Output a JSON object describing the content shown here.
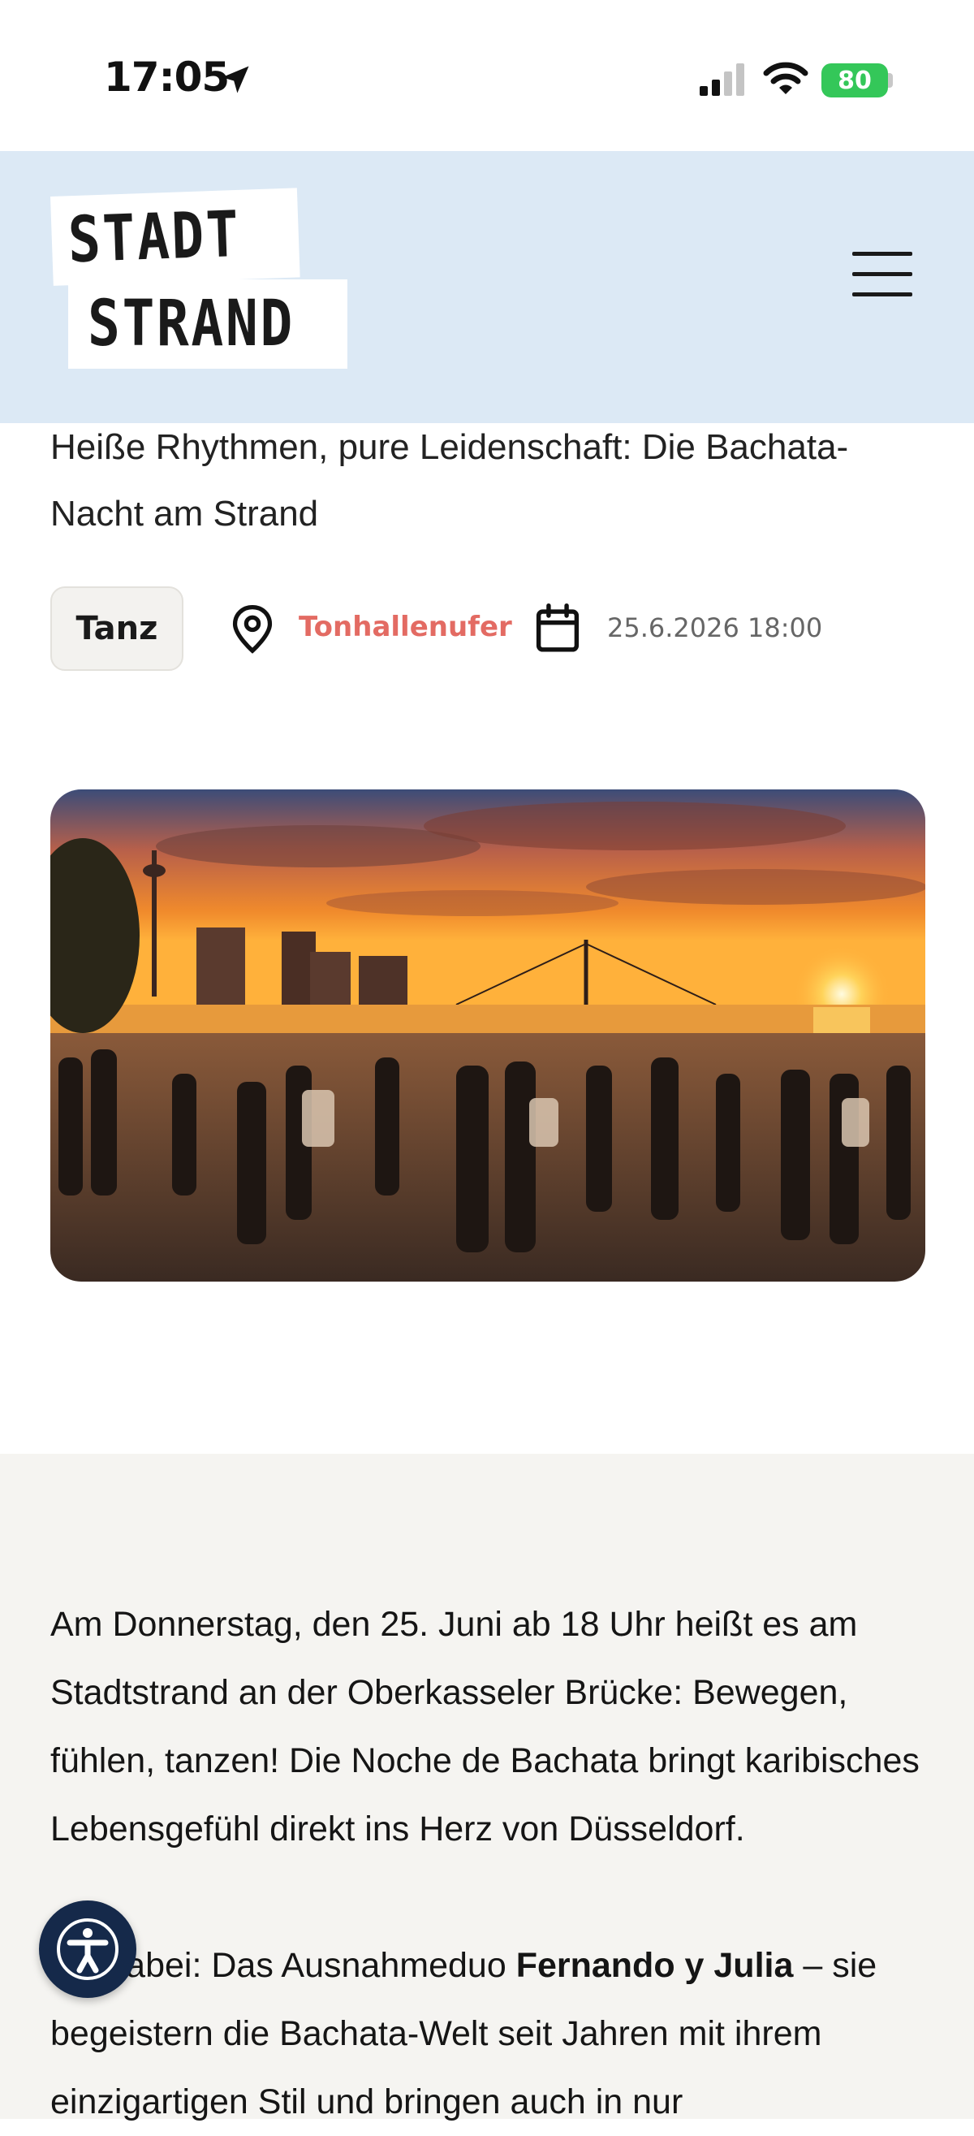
{
  "status_bar": {
    "time": "17:05",
    "battery": "80"
  },
  "header": {
    "logo_line1": "STADT",
    "logo_line2": "STRAND"
  },
  "article": {
    "title": "Heiße Rhythmen, pure Leidenschaft: Die Bachata-Nacht am Strand",
    "tag": "Tanz",
    "location": "Tonhallenufer",
    "date": "25.6.2026 18:00",
    "para1": "Am Donnerstag, den 25. Juni ab 18 Uhr heißt es am Stadtstrand an der Oberkasseler Brücke: Bewegen, fühlen, tanzen! Die Noche de Bachata bringt karibisches Lebensgefühl direkt ins Herz von Düsseldorf.",
    "para2_start": "Mit dabei: Das Ausnahmeduo ",
    "para2_bold": "Fernando y Julia",
    "para2_end": " – sie begeistern die Bachata-Welt seit Jahren mit ihrem einzigartigen Stil und bringen auch in nur"
  },
  "colors": {
    "header_bg": "#dce9f5",
    "accent": "#e36b63",
    "content_bg": "#f5f4f1",
    "a11y_bg": "#15294a"
  },
  "icons": [
    "location-arrow-icon",
    "signal-icon",
    "wifi-icon",
    "battery-icon",
    "hamburger-menu-icon",
    "map-pin-icon",
    "calendar-icon",
    "accessibility-icon"
  ]
}
